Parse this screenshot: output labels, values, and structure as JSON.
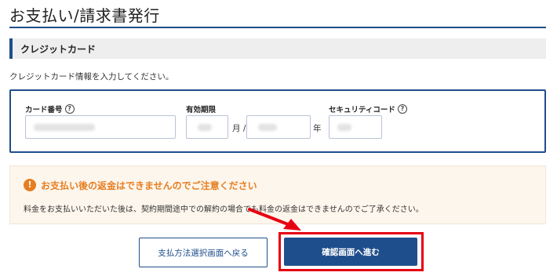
{
  "page": {
    "title": "お支払い/請求書発行"
  },
  "section": {
    "heading": "クレジットカード",
    "instruction": "クレジットカード情報を入力してください。"
  },
  "card_form": {
    "number_label": "カード番号",
    "expiry_label": "有効期限",
    "month_unit": "月 /",
    "year_unit": "年",
    "cvc_label": "セキュリティコード",
    "help_glyph": "?"
  },
  "notice": {
    "icon_glyph": "!",
    "title": "お支払い後の返金はできませんのでご注意ください",
    "body": "料金をお支払いいただいた後は、契約期間途中での解約の場合でも料金の返金はできませんのでご了承ください。"
  },
  "buttons": {
    "back_label": "支払方法選択画面へ戻る",
    "next_label": "確認画面へ進む"
  },
  "colors": {
    "brand": "#1f4e8c",
    "warning": "#e67e22",
    "highlight": "#e60012"
  }
}
